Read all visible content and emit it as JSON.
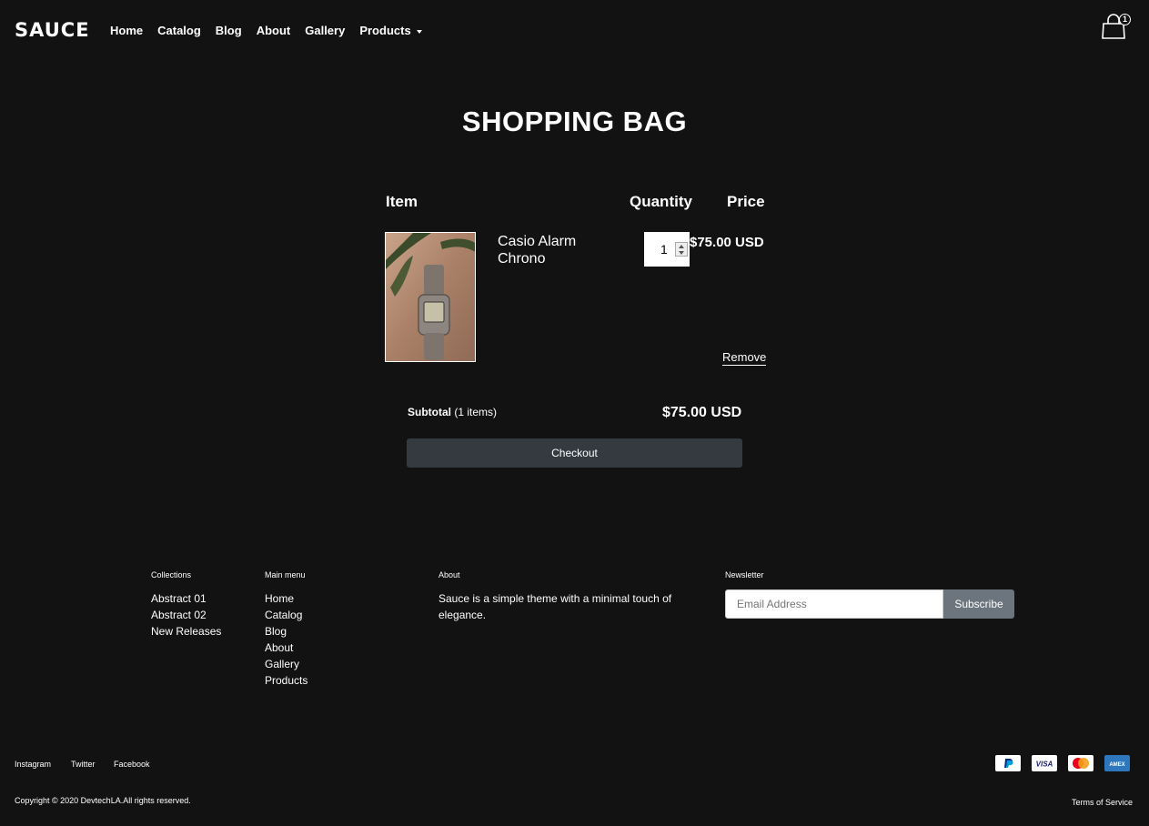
{
  "header": {
    "logo": "SAUCE",
    "nav": [
      "Home",
      "Catalog",
      "Blog",
      "About",
      "Gallery",
      "Products"
    ],
    "cart_count": "1"
  },
  "page": {
    "title": "SHOPPING BAG"
  },
  "cart": {
    "headers": {
      "item": "Item",
      "quantity": "Quantity",
      "price": "Price"
    },
    "items": [
      {
        "name": "Casio Alarm Chrono",
        "quantity": "1",
        "price": "$75.00 USD",
        "remove_label": "Remove"
      }
    ],
    "subtotal_label": "Subtotal",
    "subtotal_count": "(1 items)",
    "subtotal_value": "$75.00 USD",
    "checkout_label": "Checkout"
  },
  "footer": {
    "collections": {
      "heading": "Collections",
      "items": [
        "Abstract 01",
        "Abstract 02",
        "New Releases"
      ]
    },
    "main_menu": {
      "heading": "Main menu",
      "items": [
        "Home",
        "Catalog",
        "Blog",
        "About",
        "Gallery",
        "Products"
      ]
    },
    "about": {
      "heading": "About",
      "text": "Sauce is a simple theme with a minimal touch of elegance."
    },
    "newsletter": {
      "heading": "Newsletter",
      "placeholder": "Email Address",
      "button": "Subscribe"
    },
    "social": [
      "Instagram",
      "Twitter",
      "Facebook"
    ],
    "copyright": "Copyright © 2020 DevtechLA.All rights reserved.",
    "terms": "Terms of Service",
    "payments": [
      "paypal-icon",
      "visa-icon",
      "mastercard-icon",
      "amex-icon"
    ]
  },
  "colors": {
    "background": "#121212",
    "checkout": "#343a40",
    "subscribe": "#6c757d",
    "amex": "#2e77bc"
  }
}
